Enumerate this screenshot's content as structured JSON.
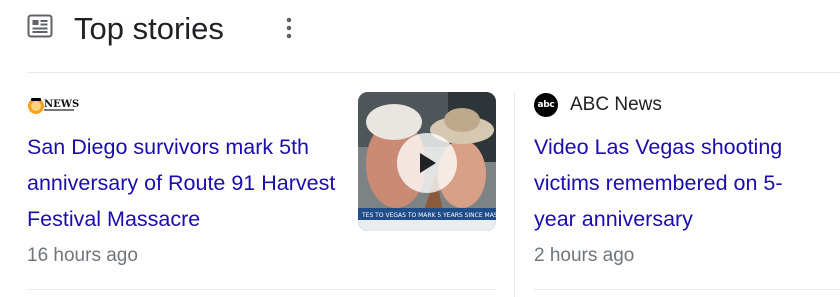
{
  "header": {
    "title": "Top stories",
    "icon": "news-icon",
    "menu_icon": "more-vert-icon"
  },
  "stories": [
    {
      "source_logo": "10news-logo",
      "headline": "San Diego survivors mark 5th anniversary of Route 91 Harvest Festival Massacre",
      "time": "16 hours ago",
      "has_video": true,
      "thumb_icon": "play-icon"
    },
    {
      "source_logo": "abc-logo",
      "logo_text": "abc",
      "source_name": "ABC News",
      "headline": "Video Las Vegas shooting victims remembered on 5-year anniversary",
      "time": "2 hours ago"
    }
  ],
  "colors": {
    "link": "#1a0dab",
    "meta": "#70757a",
    "title": "#202124",
    "divider": "#e8eaed"
  }
}
